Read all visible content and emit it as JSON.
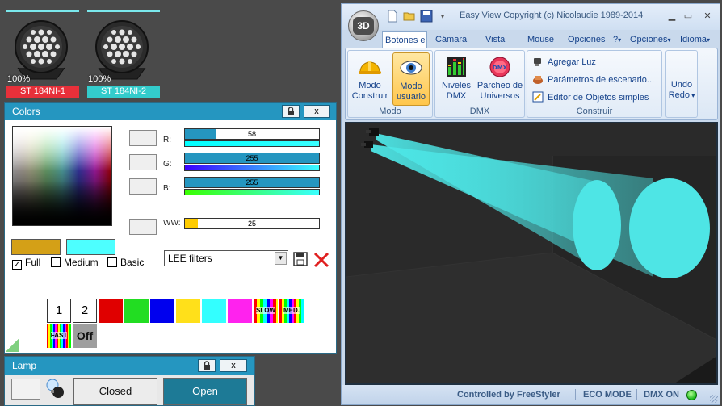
{
  "fixtures": [
    {
      "percent": "100%",
      "name": "ST 184NI-1",
      "color": "#e8303a"
    },
    {
      "percent": "100%",
      "name": "ST 184NI-2",
      "color": "#33cccc"
    }
  ],
  "colors_panel": {
    "title": "Colors",
    "lock_icon": "lock-icon",
    "close_label": "x",
    "channels": [
      {
        "label": "R:",
        "value": "58",
        "level": 0.227,
        "grad": "linear-gradient(90deg,#00ffff,#3affff)"
      },
      {
        "label": "G:",
        "value": "255",
        "level": 1.0,
        "grad": "linear-gradient(90deg,#3a00ff,#3affff)"
      },
      {
        "label": "B:",
        "value": "255",
        "level": 1.0,
        "grad": "linear-gradient(90deg,#3aff00,#3affff)"
      }
    ],
    "ww": {
      "label": "WW:",
      "value": "25",
      "level": 0.098
    },
    "current_color": "#d4a017",
    "preview_color": "#4dffff",
    "options": [
      {
        "label": "Full",
        "checked": true
      },
      {
        "label": "Medium",
        "checked": false
      },
      {
        "label": "Basic",
        "checked": false
      }
    ],
    "filter_select": "LEE filters",
    "presets": [
      "1",
      "2"
    ],
    "swatches": [
      "#e00000",
      "#22dd22",
      "#0000ee",
      "#ffe01a",
      "#33ffff",
      "#ff22ee"
    ],
    "effect_slow": "SLOW",
    "effect_med": "MED.",
    "effect_fast": "FAST",
    "off_label": "Off"
  },
  "lamp_panel": {
    "title": "Lamp",
    "close_label": "x",
    "closed_label": "Closed",
    "open_label": "Open"
  },
  "easy_view": {
    "orb_label": "3D",
    "title": "Easy View   Copyright (c) Nicolaudie 1989-2014",
    "tabs": [
      "Botones e",
      "Cámara",
      "Vista",
      "Mouse",
      "Opciones",
      "?",
      "Opciones",
      "Idioma"
    ],
    "groups": {
      "modo": {
        "label": "Modo",
        "buttons": [
          {
            "label1": "Modo",
            "label2": "Construir"
          },
          {
            "label1": "Modo",
            "label2": "usuario"
          }
        ]
      },
      "dmx": {
        "label": "DMX",
        "buttons": [
          {
            "label1": "Niveles",
            "label2": "DMX"
          },
          {
            "label1": "Parcheo de",
            "label2": "Universos"
          }
        ]
      },
      "construir": {
        "label": "Construir",
        "items": [
          "Agregar Luz",
          "Parámetros de escenario...",
          "Editor de Objetos simples"
        ]
      },
      "undo": {
        "label1": "Undo",
        "label2": "Redo"
      }
    },
    "status": {
      "controlled": "Controlled by FreeStyler",
      "eco": "ECO MODE",
      "dmx": "DMX ON"
    }
  }
}
